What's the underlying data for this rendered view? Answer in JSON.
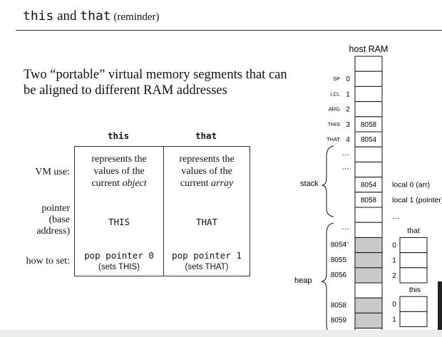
{
  "title": {
    "this_kw": "this",
    "and": " and ",
    "that_kw": "that",
    "suffix": " (reminder)"
  },
  "subtitle": "Two “portable” virtual memory segments that can be aligned to different RAM addresses",
  "table": {
    "col_this": "this",
    "col_that": "that",
    "row_vm_use": "VM use:",
    "row_pointer": [
      "pointer",
      "(base",
      "address)"
    ],
    "row_how_to_set": "how to set:",
    "this_use": [
      "represents the",
      "values of the",
      "current "
    ],
    "this_use_em": "object",
    "that_use": [
      "represents the",
      "values of the",
      "current "
    ],
    "that_use_em": "array",
    "this_pointer": "THIS",
    "that_pointer": "THAT",
    "this_set_cmd": "pop pointer 0",
    "this_set_note": "(sets THIS)",
    "that_set_cmd": "pop pointer 1",
    "that_set_note": "(sets THAT)"
  },
  "ram": {
    "title": "host RAM",
    "top_cells": [
      {
        "label": "SP",
        "index": "0",
        "value": ""
      },
      {
        "label": "LCL",
        "index": "1",
        "value": ""
      },
      {
        "label": "ARG",
        "index": "2",
        "value": ""
      },
      {
        "label": "THIS",
        "index": "3",
        "value": "8058"
      },
      {
        "label": "THAT",
        "index": "4",
        "value": "8054"
      }
    ],
    "ellipsis": "…",
    "stack_label": "stack",
    "stack_values": [
      "8054",
      "8058"
    ],
    "locals": [
      "local 0  (arr)",
      "local 1  (pointer)"
    ],
    "heap_label": "heap",
    "heap_addrs_that": [
      "8054",
      "8055",
      "8056"
    ],
    "heap_addrs_this": [
      "8058",
      "8059"
    ],
    "that_label": "that",
    "this_label": "this",
    "that_idx": [
      "0",
      "1",
      "2"
    ],
    "this_idx": [
      "0",
      "1"
    ],
    "colors": {
      "shaded": "#c9c9c9",
      "line": "#111111"
    }
  }
}
